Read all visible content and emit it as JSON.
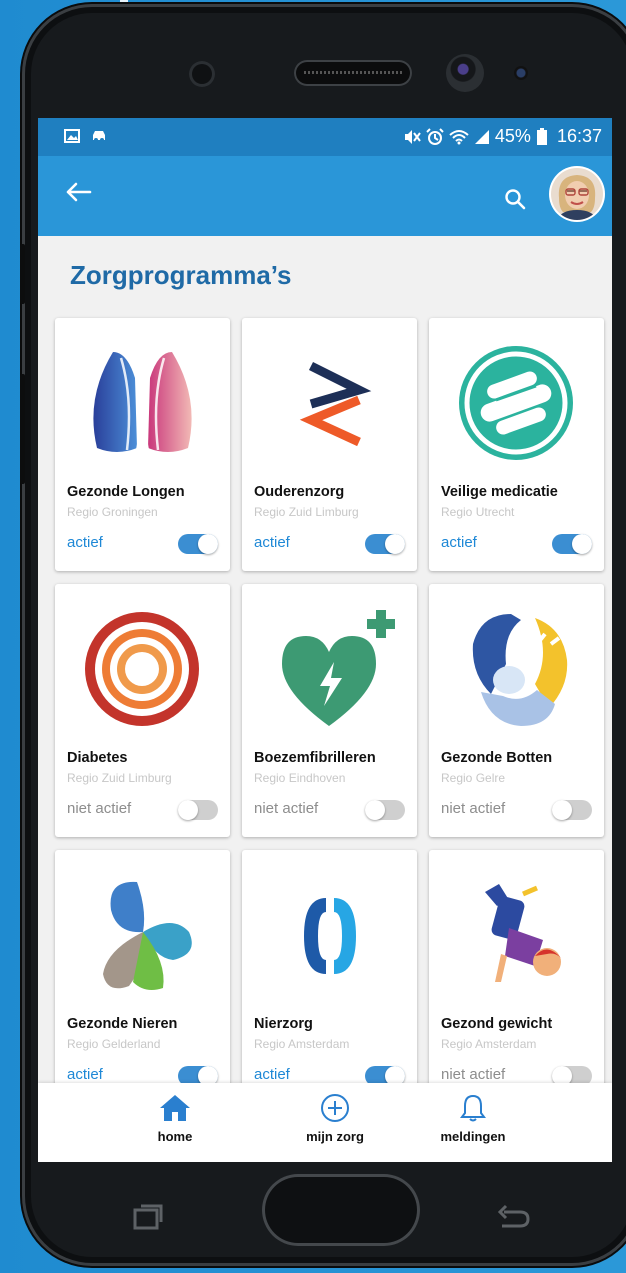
{
  "status_bar": {
    "left_icons": [
      "image-icon",
      "car-icon"
    ],
    "right_icons": [
      "mute-icon",
      "alarm-icon",
      "wifi-icon",
      "signal-icon",
      "battery-icon"
    ],
    "battery": "45%",
    "time": "16:37"
  },
  "app_bar": {
    "back_icon": "arrow-left-icon",
    "search_icon": "search-icon",
    "avatar": "user-avatar"
  },
  "page": {
    "title": "Zorgprogramma’s"
  },
  "programs": [
    {
      "title": "Gezonde Longen",
      "region": "Regio Groningen",
      "status": "actief",
      "active": true,
      "icon": "lungs-icon"
    },
    {
      "title": "Ouderenzorg",
      "region": "Regio Zuid Limburg",
      "status": "actief",
      "active": true,
      "icon": "chevrons-icon"
    },
    {
      "title": "Veilige medicatie",
      "region": "Regio Utrecht",
      "status": "actief",
      "active": true,
      "icon": "pills-icon"
    },
    {
      "title": "Diabetes",
      "region": "Regio Zuid Limburg",
      "status": "niet actief",
      "active": false,
      "icon": "target-icon"
    },
    {
      "title": "Boezemfibrilleren",
      "region": "Regio Eindhoven",
      "status": "niet actief",
      "active": false,
      "icon": "heart-bolt-icon"
    },
    {
      "title": "Gezonde Botten",
      "region": "Regio Gelre",
      "status": "niet actief",
      "active": false,
      "icon": "bones-icon"
    },
    {
      "title": "Gezonde Nieren",
      "region": "Regio Gelderland",
      "status": "actief",
      "active": true,
      "icon": "kidneys-icon"
    },
    {
      "title": "Nierzorg",
      "region": "Regio Amsterdam",
      "status": "actief",
      "active": true,
      "icon": "brackets-icon"
    },
    {
      "title": "Gezond gewicht",
      "region": "Regio Amsterdam",
      "status": "niet actief",
      "active": false,
      "icon": "breakdancer-icon"
    }
  ],
  "bottom_nav": [
    {
      "label": "home",
      "icon": "home-icon",
      "selected": true
    },
    {
      "label": "mijn zorg",
      "icon": "plus-circle-icon",
      "selected": false
    },
    {
      "label": "meldingen",
      "icon": "bell-icon",
      "selected": false
    }
  ],
  "colors": {
    "background": "#2a95d6",
    "app_bar": "#2a96d8",
    "status_bar": "#1f7fc0",
    "title": "#1f6aa6",
    "active_text": "#1e88d6",
    "toggle_on": "#3b8ed2",
    "toggle_off": "#cfcfcf"
  }
}
